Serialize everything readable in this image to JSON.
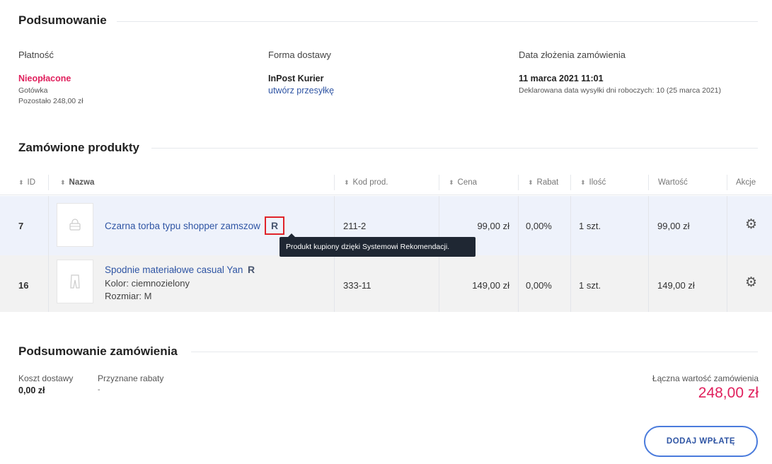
{
  "summary": {
    "title": "Podsumowanie",
    "payment": {
      "label": "Płatność",
      "status": "Nieopłacone",
      "method": "Gotówka",
      "remaining": "Pozostało 248,00 zł"
    },
    "delivery": {
      "label": "Forma dostawy",
      "carrier": "InPost Kurier",
      "create_shipment": "utwórz przesyłkę"
    },
    "order_date": {
      "label": "Data złożenia zamówienia",
      "value": "11 marca 2021 11:01",
      "declared": "Deklarowana data wysyłki dni roboczych: 10 (25 marca 2021)"
    }
  },
  "products": {
    "title": "Zamówione produkty",
    "columns": {
      "id": "ID",
      "name": "Nazwa",
      "code": "Kod prod.",
      "price": "Cena",
      "discount": "Rabat",
      "qty": "Ilość",
      "value": "Wartość",
      "actions": "Akcje"
    },
    "rows": [
      {
        "id": "7",
        "name": "Czarna torba typu shopper zamszow",
        "badge": "R",
        "details": [],
        "code": "211-2",
        "price": "99,00 zł",
        "discount": "0,00%",
        "qty": "1 szt.",
        "value": "99,00 zł"
      },
      {
        "id": "16",
        "name": "Spodnie materiałowe casual Yan",
        "badge": "R",
        "details": [
          "Kolor: ciemnozielony",
          "Rozmiar: M"
        ],
        "code": "333-11",
        "price": "149,00 zł",
        "discount": "0,00%",
        "qty": "1 szt.",
        "value": "149,00 zł"
      }
    ],
    "tooltip": "Produkt kupiony dzięki Systemowi Rekomendacji."
  },
  "order_summary": {
    "title": "Podsumowanie zamówienia",
    "shipping_cost_label": "Koszt dostawy",
    "shipping_cost": "0,00 zł",
    "discounts_label": "Przyznane rabaty",
    "discounts": "-",
    "total_label": "Łączna wartość zamówienia",
    "total": "248,00 zł",
    "add_payment_button": "DODAJ WPŁATĘ"
  },
  "colors": {
    "accent_pink": "#e01f5c",
    "link_blue": "#2f55a4",
    "highlight_red": "#e0242a"
  }
}
